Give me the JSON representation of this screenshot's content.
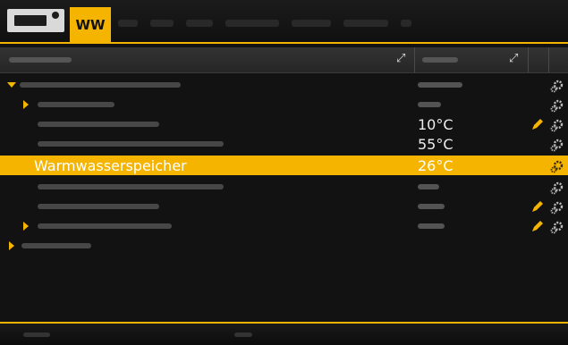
{
  "header": {
    "active_tab_label": "WW"
  },
  "table": {
    "rows": [
      {
        "label": "",
        "value": ""
      },
      {
        "label": "",
        "value": ""
      },
      {
        "label": "",
        "value": "10°C"
      },
      {
        "label": "",
        "value": "55°C"
      },
      {
        "label": "Warmwasserspeicher",
        "value": "26°C"
      },
      {
        "label": "",
        "value": ""
      },
      {
        "label": "",
        "value": ""
      },
      {
        "label": "",
        "value": ""
      },
      {
        "label": "",
        "value": ""
      }
    ]
  },
  "colors": {
    "accent": "#f4b400",
    "background": "#121212",
    "header_bg": "#2c2c2c"
  },
  "icons": {
    "logo": "eta-logo",
    "expand": "expand-diagonal-icon",
    "edit": "pencil-icon",
    "settings": "gear-icon",
    "tree_expand": "caret-right-icon",
    "tree_collapse": "caret-down-icon"
  }
}
